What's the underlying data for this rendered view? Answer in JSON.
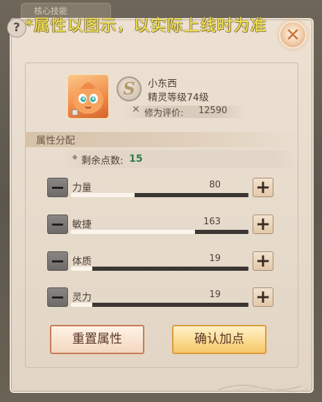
{
  "background_tab": "核心技能",
  "notice": "*属性以图示，以实际上线时为准",
  "pet": {
    "name": "小东西",
    "level": "精灵等级74级",
    "rank": "S",
    "rating_label": "修为评价:",
    "rating_value": "12590"
  },
  "section_title": "属性分配",
  "points": {
    "label": "剩余点数:",
    "value": "15"
  },
  "attributes": [
    {
      "name": "力量",
      "value": "80",
      "fill": 0.36
    },
    {
      "name": "敏捷",
      "value": "163",
      "fill": 0.7
    },
    {
      "name": "体质",
      "value": "19",
      "fill": 0.12
    },
    {
      "name": "灵力",
      "value": "19",
      "fill": 0.12
    }
  ],
  "buttons": {
    "reset": "重置属性",
    "confirm": "确认加点"
  },
  "colors": {
    "points_value": "#2e7c45",
    "notice": "#f6eb52",
    "confirm_bg": "#fbd98e"
  },
  "icons": {
    "help": "?",
    "close": "✕",
    "rating": "✕",
    "diamond": "◆",
    "plus": "+"
  }
}
